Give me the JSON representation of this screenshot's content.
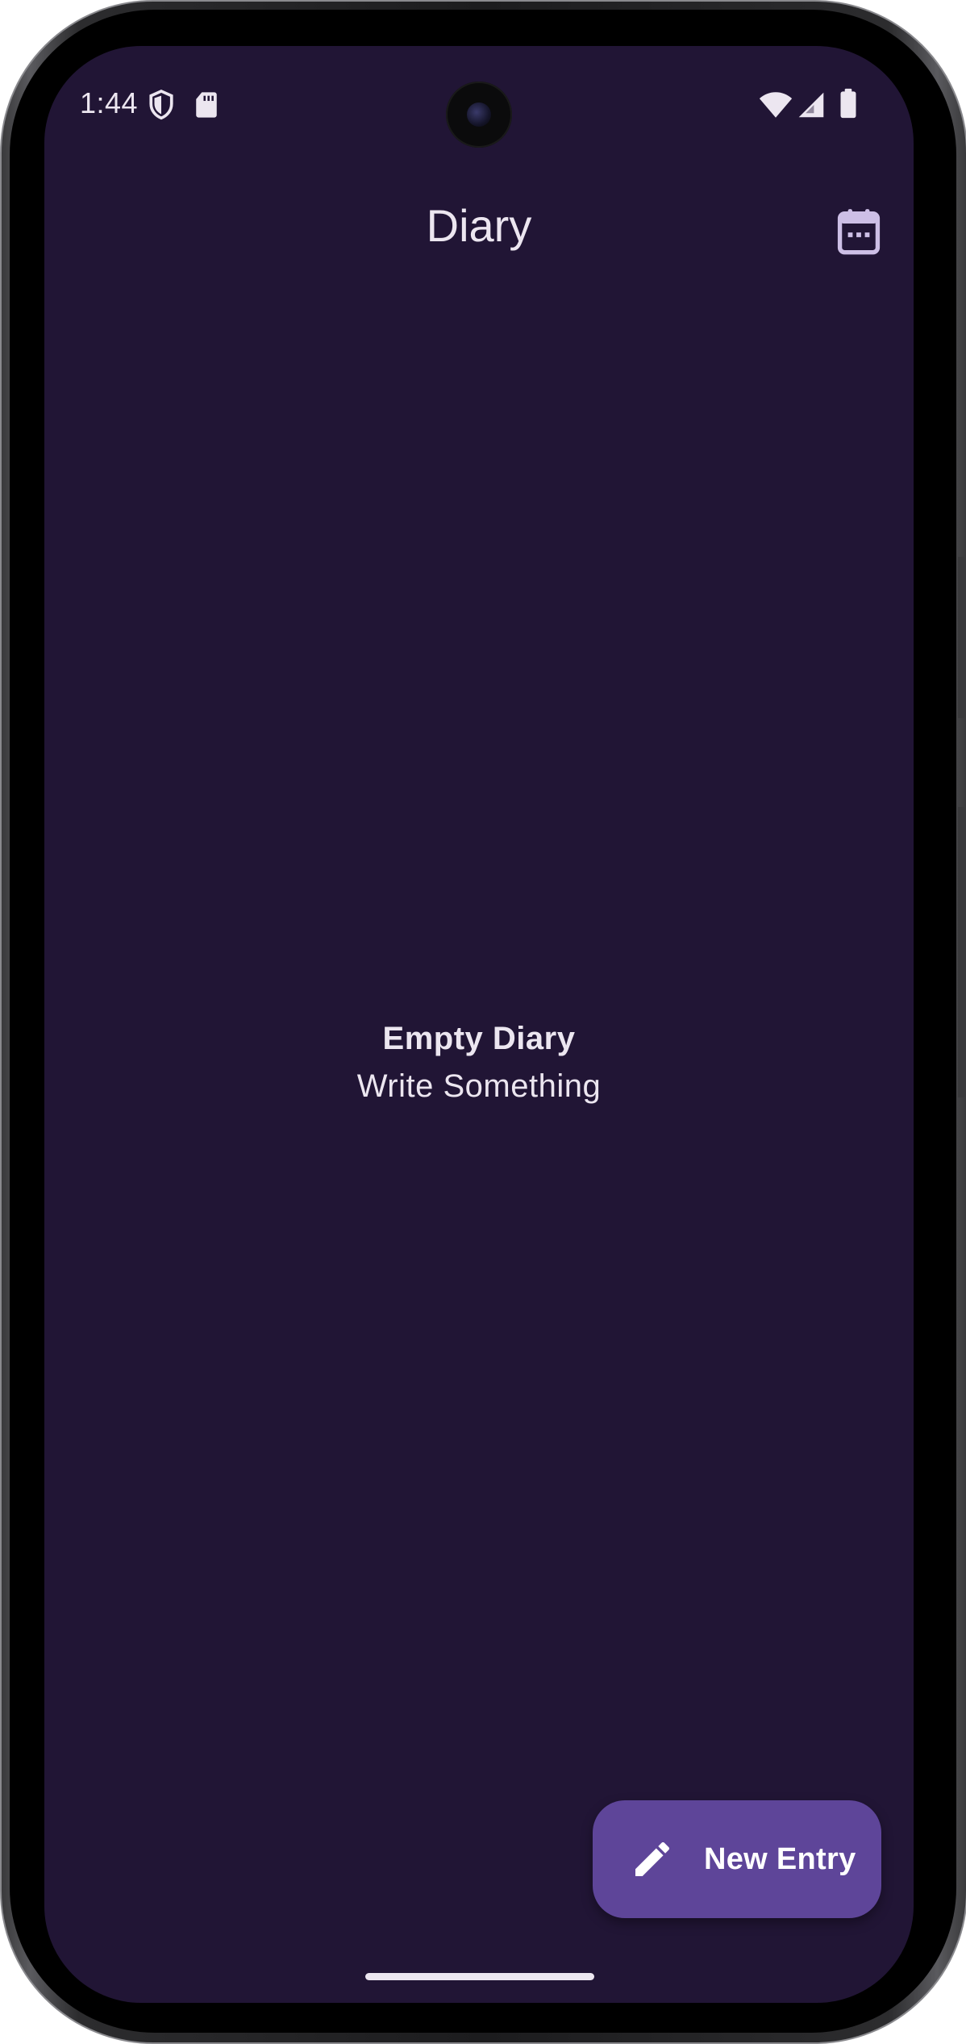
{
  "status_bar": {
    "time": "1:44",
    "left_icons": [
      "shield-icon",
      "sd-card-icon"
    ],
    "right_icons": [
      "wifi-icon",
      "cellular-signal-icon",
      "battery-icon"
    ]
  },
  "app_bar": {
    "title": "Diary",
    "action_icon": "calendar-icon"
  },
  "empty_state": {
    "title": "Empty Diary",
    "subtitle": "Write Something"
  },
  "fab": {
    "icon": "pencil-icon",
    "label": "New Entry"
  },
  "colors": {
    "background": "#211535",
    "on_background": "#ece6f0",
    "fab_container": "#5e4599",
    "fab_content": "#ffffff",
    "icon_muted": "#cdbfe6"
  }
}
